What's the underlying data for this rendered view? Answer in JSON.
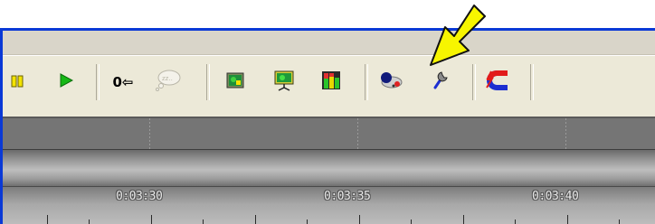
{
  "toolbar": {
    "reset_counter_label": "0⇦",
    "items": [
      {
        "name": "pause-button"
      },
      {
        "name": "play-button"
      },
      {
        "name": "reset-counter-button"
      },
      {
        "name": "comment-button"
      },
      {
        "name": "picture-button"
      },
      {
        "name": "presentation-button"
      },
      {
        "name": "levels-button"
      },
      {
        "name": "paint-button"
      },
      {
        "name": "wrench-button"
      },
      {
        "name": "magnet-button"
      }
    ],
    "icons": {
      "pause": "pause-icon",
      "play": "play-icon",
      "comment": "speech-bubble-icon",
      "picture": "picture-icon",
      "presentation": "presentation-board-icon",
      "levels": "level-meter-icon",
      "paint": "paint-palette-icon",
      "wrench": "wrench-icon",
      "magnet": "magnet-icon"
    }
  },
  "timeline": {
    "labels": [
      "0:03:30",
      "0:03:35",
      "0:03:40"
    ]
  },
  "annotation": {
    "arrow_color": "#f7f500",
    "arrow_icon": "callout-arrow-icon"
  },
  "colors": {
    "frame": "#0a39d6",
    "toolbar": "#ece9d8",
    "play_green": "#16b816",
    "pause_yellow": "#f3e400",
    "magnet_red": "#e21b1b",
    "magnet_blue": "#1d2fd1"
  }
}
